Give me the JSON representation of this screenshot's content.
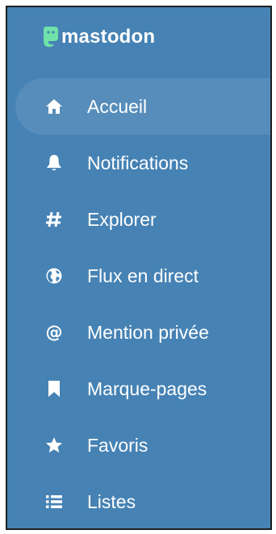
{
  "app": {
    "logo_text": "mastodon",
    "colors": {
      "background": "#4682b4",
      "text": "#ffffff",
      "logo_mark": "#6ee1a8"
    }
  },
  "nav": {
    "items": [
      {
        "label": "Accueil",
        "icon": "home-icon",
        "active": true
      },
      {
        "label": "Notifications",
        "icon": "bell-icon",
        "active": false
      },
      {
        "label": "Explorer",
        "icon": "hashtag-icon",
        "active": false
      },
      {
        "label": "Flux en direct",
        "icon": "globe-icon",
        "active": false
      },
      {
        "label": "Mention privée",
        "icon": "at-icon",
        "active": false
      },
      {
        "label": "Marque-pages",
        "icon": "bookmark-icon",
        "active": false
      },
      {
        "label": "Favoris",
        "icon": "star-icon",
        "active": false
      },
      {
        "label": "Listes",
        "icon": "list-icon",
        "active": false
      }
    ]
  }
}
